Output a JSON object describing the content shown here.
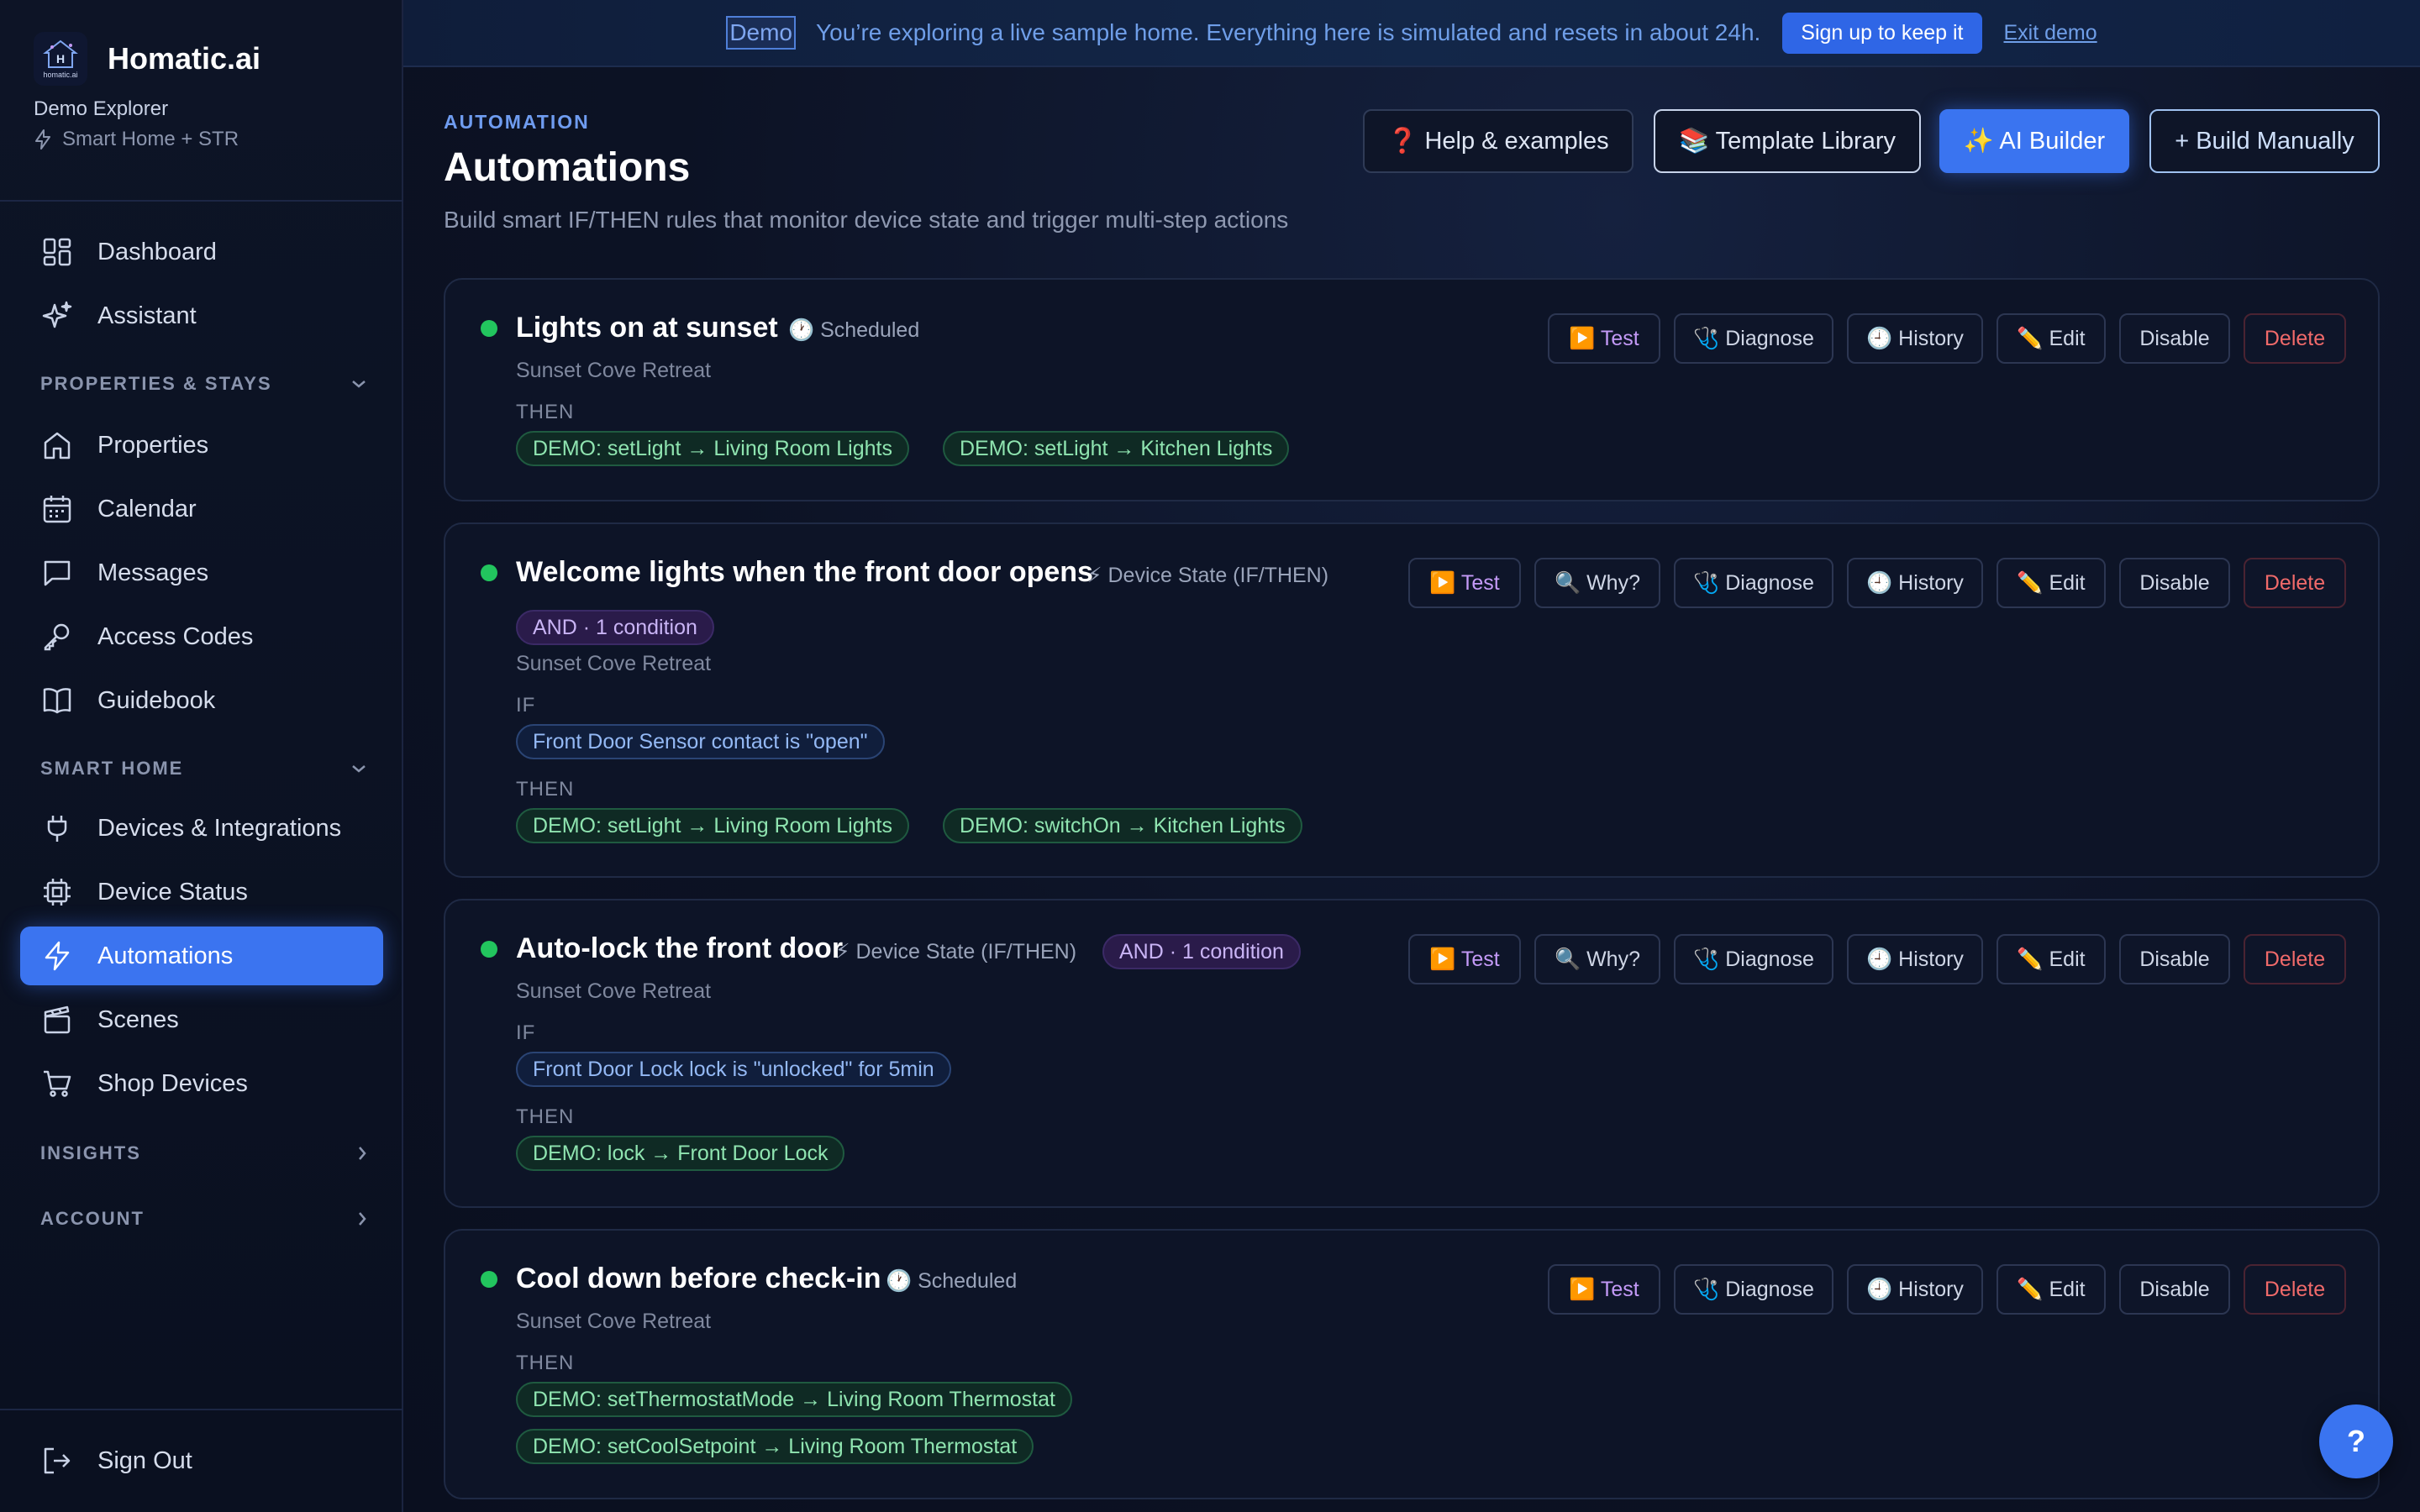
{
  "banner": {
    "tag": "Demo",
    "text": "You’re exploring a live sample home. Everything here is simulated and resets in about 24h.",
    "signup_label": "Sign up to keep it",
    "exit_label": "Exit demo"
  },
  "sidebar": {
    "brand": "Homatic.ai",
    "logo_text": "homatic.ai",
    "user": "Demo Explorer",
    "plan": "Smart Home + STR",
    "items_top": [
      {
        "label": "Dashboard",
        "icon": "dashboard-icon"
      },
      {
        "label": "Assistant",
        "icon": "sparkles-icon"
      }
    ],
    "section_properties": "PROPERTIES & STAYS",
    "items_properties": [
      {
        "label": "Properties",
        "icon": "home-icon"
      },
      {
        "label": "Calendar",
        "icon": "calendar-icon"
      },
      {
        "label": "Messages",
        "icon": "message-icon"
      },
      {
        "label": "Access Codes",
        "icon": "key-icon"
      },
      {
        "label": "Guidebook",
        "icon": "book-icon"
      }
    ],
    "section_smart_home": "SMART HOME",
    "items_smart_home": [
      {
        "label": "Devices & Integrations",
        "icon": "plug-icon"
      },
      {
        "label": "Device Status",
        "icon": "chip-icon"
      },
      {
        "label": "Automations",
        "icon": "lightning-icon"
      },
      {
        "label": "Scenes",
        "icon": "clapperboard-icon"
      },
      {
        "label": "Shop Devices",
        "icon": "cart-icon"
      }
    ],
    "section_insights": "INSIGHTS",
    "section_account": "ACCOUNT",
    "sign_out": "Sign Out"
  },
  "header": {
    "kicker": "AUTOMATION",
    "title": "Automations",
    "subtitle": "Build smart IF/THEN rules that monitor device state and trigger multi-step actions",
    "help_label": "❓ Help & examples",
    "library_label": "📚 Template Library",
    "ai_label": "✨ AI Builder",
    "manual_label": "+ Build Manually"
  },
  "labels": {
    "if": "IF",
    "then": "THEN",
    "test": "▶️ Test",
    "why": "🔍 Why?",
    "diagnose": "🩺 Diagnose",
    "history": "🕘 History",
    "edit": "✏️ Edit",
    "disable": "Disable",
    "delete": "Delete"
  },
  "automations": [
    {
      "title": "Lights on at sunset",
      "type": "🕐 Scheduled",
      "property": "Sunset Cove Retreat",
      "actions": [
        "DEMO: setLight → Living Room Lights",
        "DEMO: setLight → Kitchen Lights"
      ]
    },
    {
      "title": "Welcome lights when the front door opens",
      "type": "⚡ Device State (IF/THEN)",
      "logic": "AND · 1 condition",
      "property": "Sunset Cove Retreat",
      "condition": "Front Door Sensor contact is \"open\"",
      "actions": [
        "DEMO: setLight → Living Room Lights",
        "DEMO: switchOn → Kitchen Lights"
      ]
    },
    {
      "title": "Auto-lock the front door",
      "type": "⚡ Device State (IF/THEN)",
      "logic": "AND · 1 condition",
      "property": "Sunset Cove Retreat",
      "condition": "Front Door Lock lock is \"unlocked\" for 5min",
      "actions": [
        "DEMO: lock → Front Door Lock"
      ]
    },
    {
      "title": "Cool down before check-in",
      "type": "🕐 Scheduled",
      "property": "Sunset Cove Retreat",
      "actions": [
        "DEMO: setThermostatMode → Living Room Thermostat",
        "DEMO: setCoolSetpoint → Living Room Thermostat"
      ]
    }
  ],
  "fab_label": "?",
  "colors": {
    "accent": "#3a74f0",
    "status_active": "#22c55e",
    "delete": "#f06a6a"
  }
}
